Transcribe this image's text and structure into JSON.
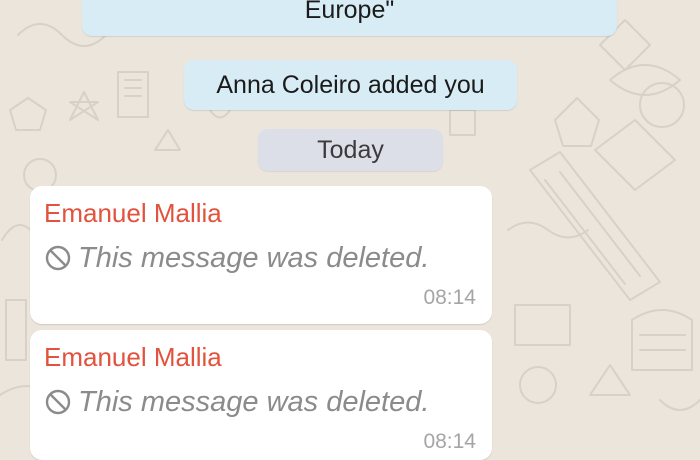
{
  "chat": {
    "group_description_tail": "Europe\"",
    "added_notice": "Anna Coleiro added you",
    "date_separator": "Today",
    "messages": [
      {
        "sender": "Emanuel Mallia",
        "text": "This message was deleted.",
        "time": "08:14",
        "icon": "deleted-circle-icon"
      },
      {
        "sender": "Emanuel Mallia",
        "text": "This message was deleted.",
        "time": "08:14",
        "icon": "deleted-circle-icon"
      }
    ]
  },
  "colors": {
    "wallpaper": "#ece5dc",
    "system_bubble": "#d8ecf6",
    "date_pill": "#dcdfe8",
    "sender_name": "#e2523d",
    "deleted_text": "#8b8b8b",
    "timestamp": "#a5a5a5",
    "message_bubble": "#ffffff"
  }
}
